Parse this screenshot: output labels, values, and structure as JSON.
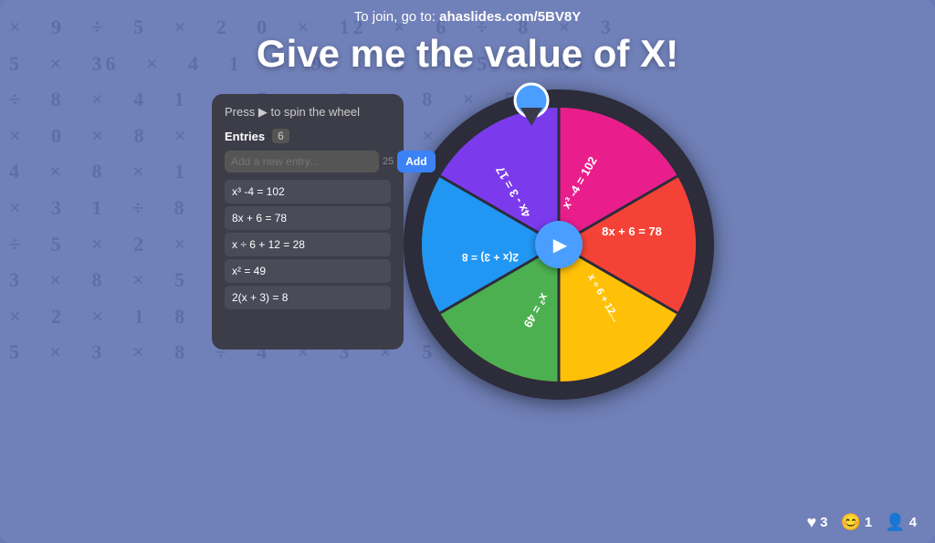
{
  "join_text": "To join, go to: ",
  "join_url": "ahaslides.com/5BV8Y",
  "title": "Give me the value of X!",
  "panel": {
    "press_text": "Press ▶ to spin the wheel",
    "entries_label": "Entries",
    "entries_count": "6",
    "input_placeholder": "Add a new entry...",
    "input_max": "25",
    "add_button_label": "Add",
    "entries": [
      "x³ -4 = 102",
      "8x + 6 = 78",
      "x ÷ 6 + 12 = 28",
      "x² = 49",
      "2(x + 3) = 8"
    ]
  },
  "wheel": {
    "segments": [
      {
        "label": "x³ -4 = 102",
        "color": "#e91e8c"
      },
      {
        "label": "8x + 6 = 78",
        "color": "#f44336"
      },
      {
        "label": "x ÷ 6 + 12 = ...",
        "color": "#ff9800"
      },
      {
        "label": "x² = 49",
        "color": "#4caf50"
      },
      {
        "label": "2(x + 3) = 8",
        "color": "#2196f3"
      },
      {
        "label": "4x - 3 = 17",
        "color": "#7c3aed"
      }
    ]
  },
  "footer": {
    "hearts": "3",
    "emoji": "1",
    "users": "4",
    "hearts_icon": "♥",
    "emoji_icon": "😊",
    "users_icon": "👤"
  }
}
